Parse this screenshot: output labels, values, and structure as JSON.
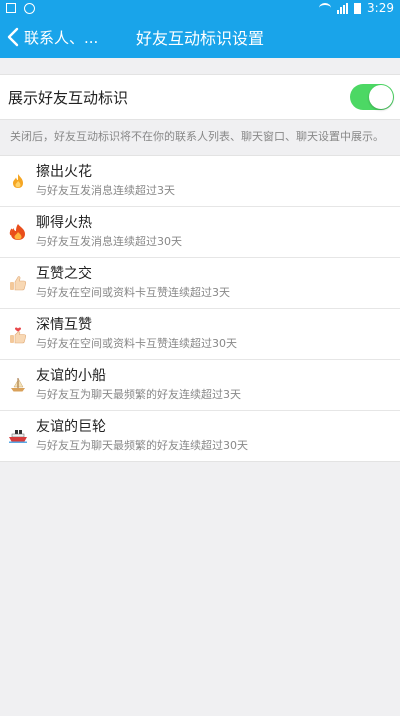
{
  "statusbar": {
    "time": "3:29"
  },
  "navbar": {
    "back_label": "联系人、...",
    "title": "好友互动标识设置"
  },
  "toggle": {
    "label": "展示好友互动标识",
    "enabled": true,
    "color": "#4cd864"
  },
  "note": "关闭后，好友互动标识将不在你的联系人列表、聊天窗口、聊天设置中展示。",
  "accent_color": "#19a4ea",
  "items": [
    {
      "icon": "small-flame-icon",
      "title": "擦出火花",
      "desc": "与好友互发消息连续超过3天"
    },
    {
      "icon": "big-flame-icon",
      "title": "聊得火热",
      "desc": "与好友互发消息连续超过30天"
    },
    {
      "icon": "thumbs-up-icon",
      "title": "互赞之交",
      "desc": "与好友在空间或资料卡互赞连续超过3天"
    },
    {
      "icon": "thumbs-up-heart-icon",
      "title": "深情互赞",
      "desc": "与好友在空间或资料卡互赞连续超过30天"
    },
    {
      "icon": "small-boat-icon",
      "title": "友谊的小船",
      "desc": "与好友互为聊天最频繁的好友连续超过3天"
    },
    {
      "icon": "big-ship-icon",
      "title": "友谊的巨轮",
      "desc": "与好友互为聊天最频繁的好友连续超过30天"
    }
  ]
}
